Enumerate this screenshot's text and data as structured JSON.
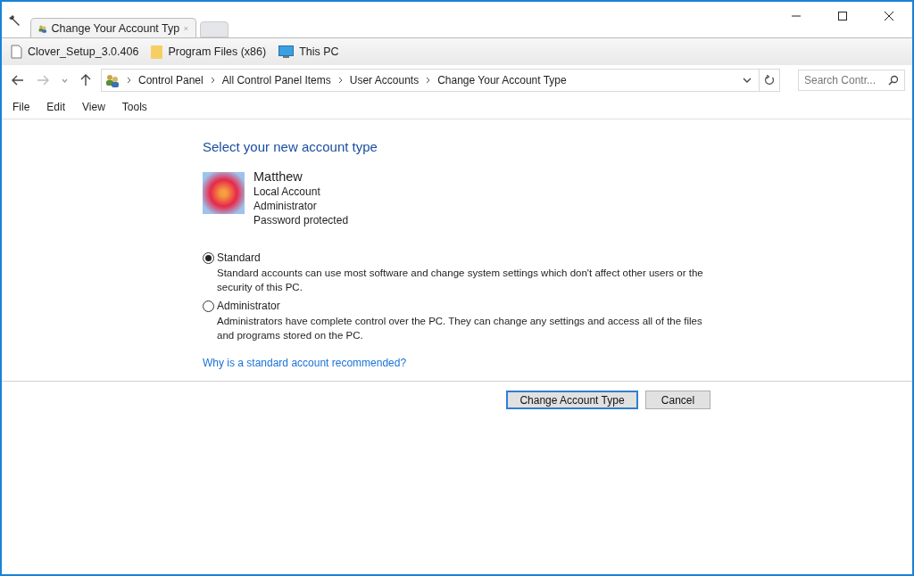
{
  "tab": {
    "title": "Change Your Account Typ"
  },
  "bookmarks": [
    {
      "kind": "file",
      "label": "Clover_Setup_3.0.406"
    },
    {
      "kind": "folder",
      "label": "Program Files (x86)"
    },
    {
      "kind": "pc",
      "label": "This PC"
    }
  ],
  "address": {
    "crumbs": [
      "Control Panel",
      "All Control Panel Items",
      "User Accounts",
      "Change Your Account Type"
    ]
  },
  "search": {
    "placeholder": "Search Contr..."
  },
  "menu": [
    "File",
    "Edit",
    "View",
    "Tools"
  ],
  "heading": "Select your new account type",
  "account": {
    "name": "Matthew",
    "details": [
      "Local Account",
      "Administrator",
      "Password protected"
    ]
  },
  "options": [
    {
      "label": "Standard",
      "description": "Standard accounts can use most software and change system settings which don't affect other users or the security of this PC.",
      "selected": true
    },
    {
      "label": "Administrator",
      "description": "Administrators have complete control over the PC. They can change any settings and access all of the files and programs stored on the PC.",
      "selected": false
    }
  ],
  "link": "Why is a standard account recommended?",
  "buttons": [
    {
      "label": "Change Account Type",
      "default": true
    },
    {
      "label": "Cancel",
      "default": false
    }
  ]
}
